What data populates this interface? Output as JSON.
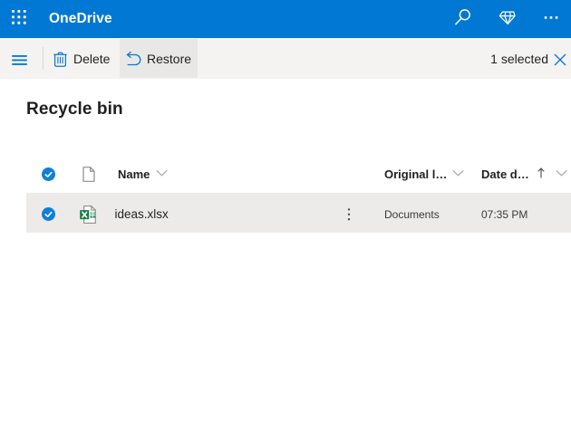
{
  "app": {
    "title": "OneDrive"
  },
  "colors": {
    "accent": "#0078d4",
    "command_bar_bg": "#f4f3f1",
    "selected_row_bg": "#ecebe9"
  },
  "top_bar": {
    "icons": [
      "app-launcher",
      "search",
      "premium",
      "more"
    ]
  },
  "command_bar": {
    "delete_label": "Delete",
    "restore_label": "Restore",
    "selection_status": "1 selected"
  },
  "page": {
    "title": "Recycle bin"
  },
  "table": {
    "columns": {
      "name": {
        "label": "Name",
        "sortable": true
      },
      "original_location": {
        "label": "Original l…",
        "sortable": true
      },
      "date_deleted": {
        "label": "Date d…",
        "sortable": true,
        "sort_direction": "ascending"
      }
    },
    "rows": [
      {
        "name": "ideas.xlsx",
        "file_type": "xlsx",
        "original_location": "Documents",
        "date_deleted": "07:35 PM",
        "selected": true
      }
    ]
  }
}
